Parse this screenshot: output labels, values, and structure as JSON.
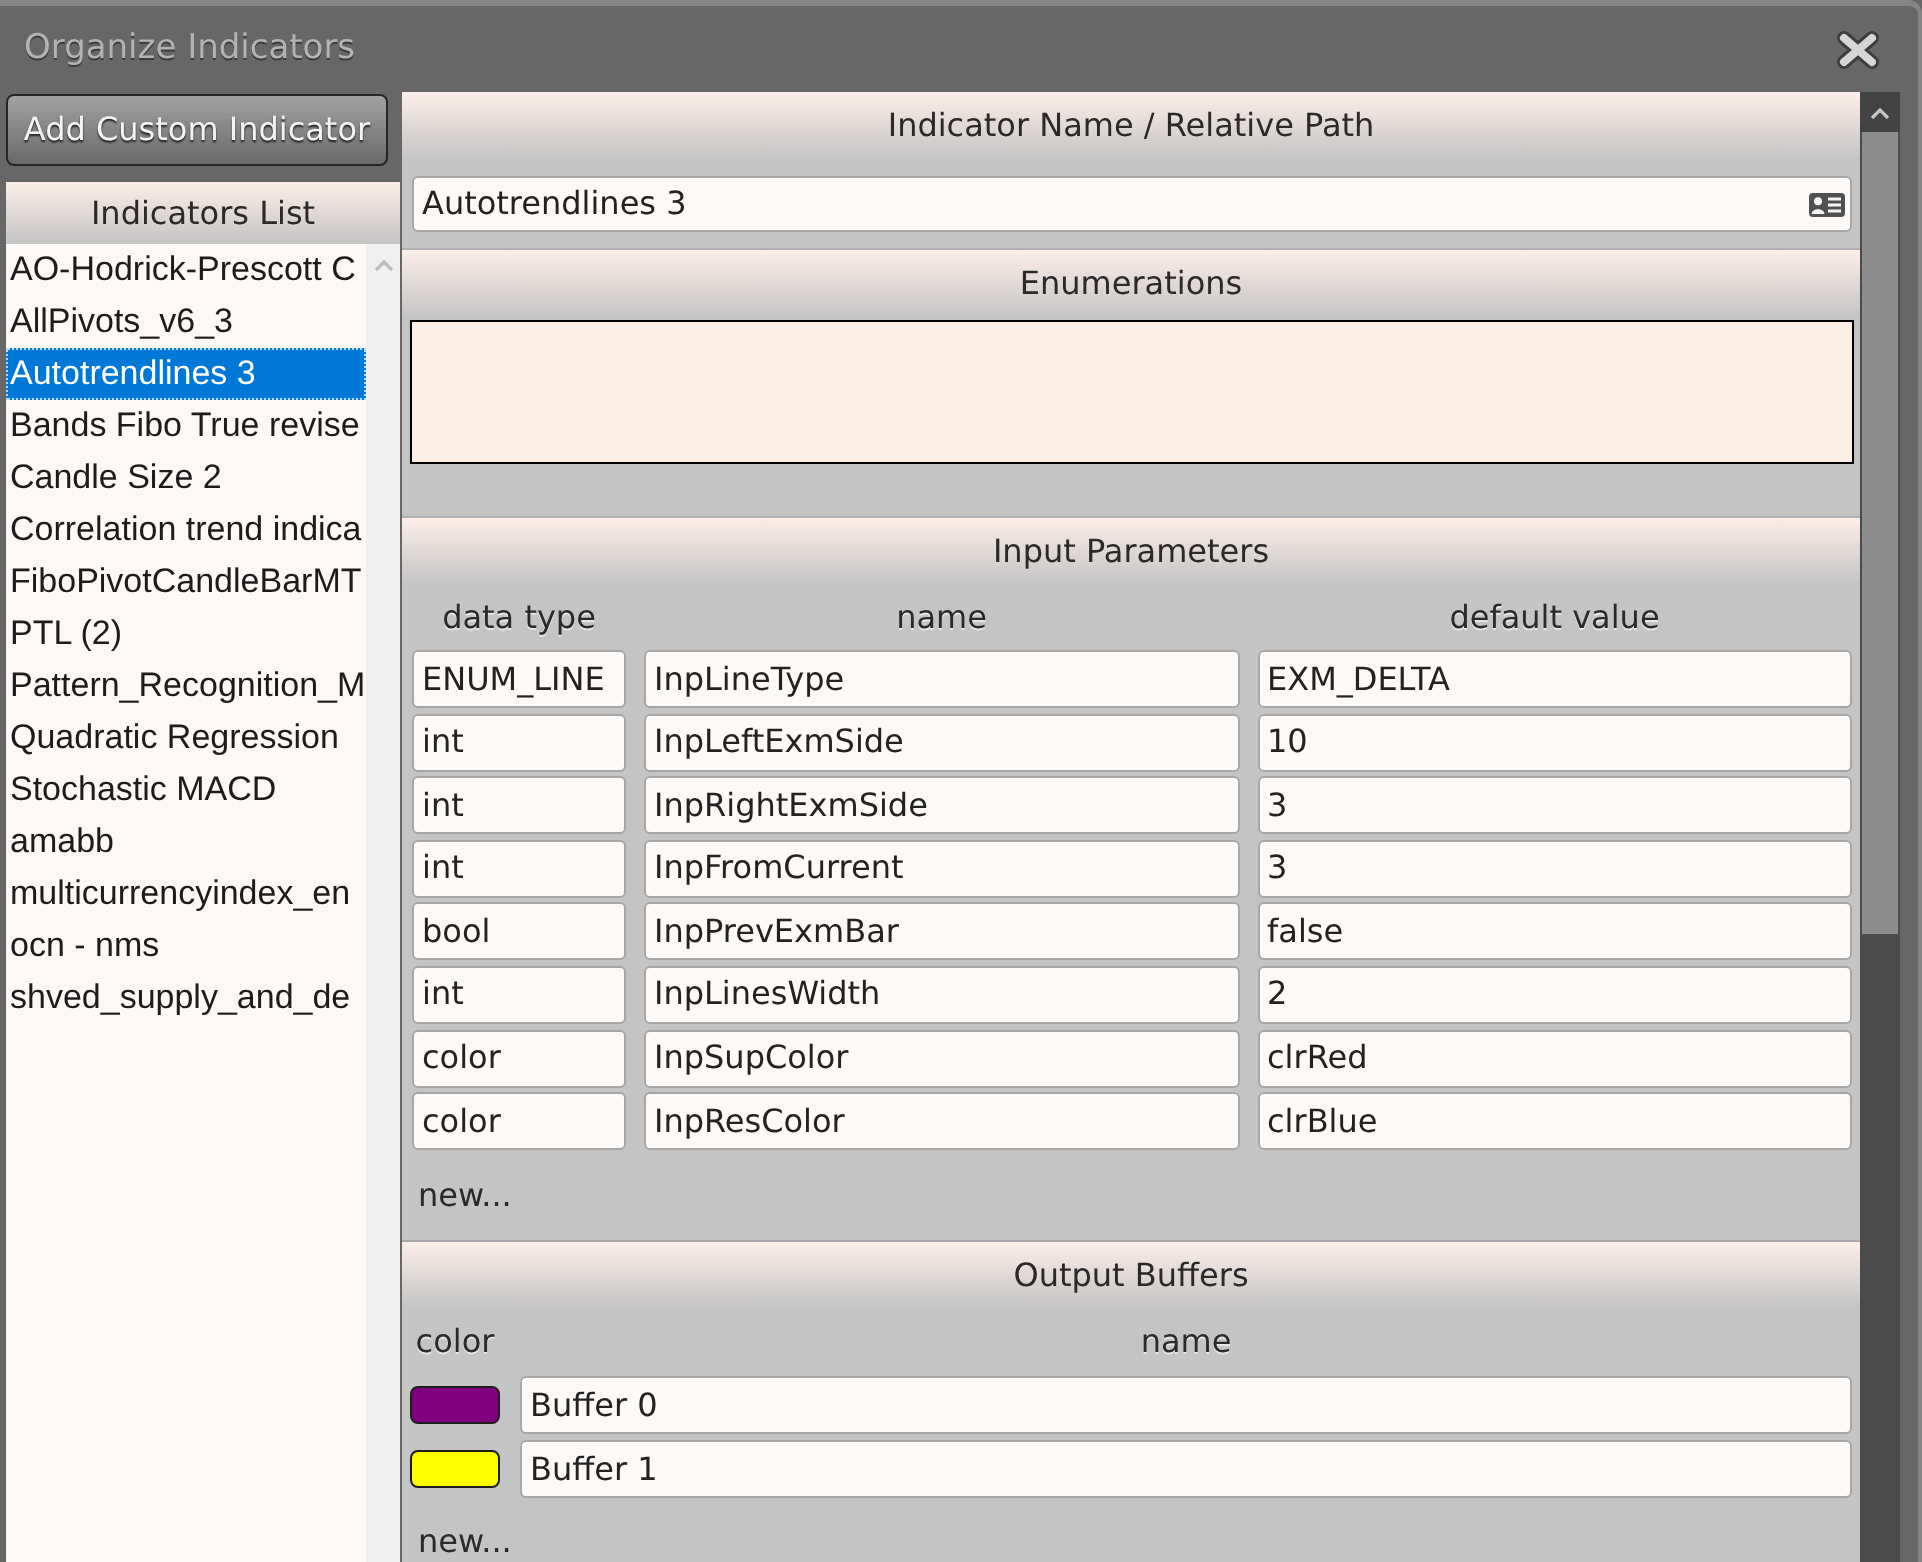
{
  "window": {
    "title": "Organize Indicators"
  },
  "sidebar": {
    "add_button": "Add Custom Indicator",
    "list_title": "Indicators List",
    "items": [
      {
        "label": "AO-Hodrick-Prescott C",
        "selected": false
      },
      {
        "label": "AllPivots_v6_3",
        "selected": false
      },
      {
        "label": "Autotrendlines 3",
        "selected": true
      },
      {
        "label": "Bands Fibo True revise",
        "selected": false
      },
      {
        "label": "Candle Size 2",
        "selected": false
      },
      {
        "label": "Correlation trend indica",
        "selected": false
      },
      {
        "label": "FiboPivotCandleBarMT",
        "selected": false
      },
      {
        "label": "PTL (2)",
        "selected": false
      },
      {
        "label": "Pattern_Recognition_M",
        "selected": false
      },
      {
        "label": "Quadratic Regression",
        "selected": false
      },
      {
        "label": "Stochastic MACD",
        "selected": false
      },
      {
        "label": "amabb",
        "selected": false
      },
      {
        "label": "multicurrencyindex_en",
        "selected": false
      },
      {
        "label": "ocn - nms",
        "selected": false
      },
      {
        "label": "shved_supply_and_de",
        "selected": false
      }
    ]
  },
  "indicator_name": {
    "title": "Indicator Name / Relative Path",
    "value": "Autotrendlines 3"
  },
  "enumerations": {
    "title": "Enumerations"
  },
  "input_parameters": {
    "title": "Input Parameters",
    "columns": [
      "data type",
      "name",
      "default value"
    ],
    "rows": [
      {
        "data_type": "ENUM_LINE",
        "name": "InpLineType",
        "default_value": "EXM_DELTA"
      },
      {
        "data_type": "int",
        "name": "InpLeftExmSide",
        "default_value": "10"
      },
      {
        "data_type": "int",
        "name": "InpRightExmSide",
        "default_value": "3"
      },
      {
        "data_type": "int",
        "name": "InpFromCurrent",
        "default_value": "3"
      },
      {
        "data_type": "bool",
        "name": "InpPrevExmBar",
        "default_value": "false"
      },
      {
        "data_type": "int",
        "name": "InpLinesWidth",
        "default_value": "2"
      },
      {
        "data_type": "color",
        "name": "InpSupColor",
        "default_value": "clrRed"
      },
      {
        "data_type": "color",
        "name": "InpResColor",
        "default_value": "clrBlue"
      }
    ],
    "new_link": "new..."
  },
  "output_buffers": {
    "title": "Output Buffers",
    "columns": [
      "color",
      "name"
    ],
    "rows": [
      {
        "color": "#800080",
        "name": "Buffer 0"
      },
      {
        "color": "#ffff00",
        "name": "Buffer 1"
      }
    ],
    "new_link": "new..."
  }
}
